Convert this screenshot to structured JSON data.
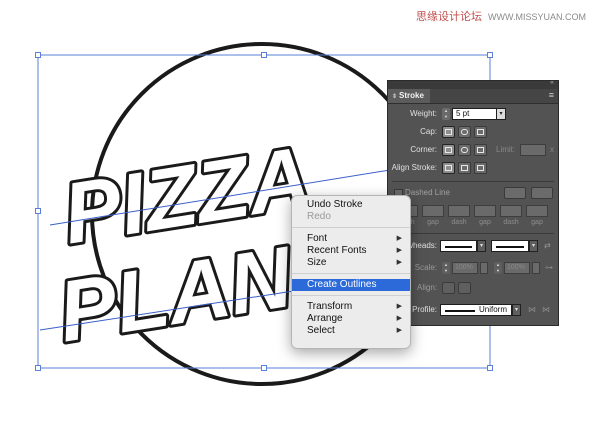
{
  "watermark": {
    "site_cn": "思缘设计论坛",
    "site_url": "WWW.MISSYUAN.COM"
  },
  "artwork": {
    "line1": "PIZZA",
    "line2": "PLANET"
  },
  "stroke_panel": {
    "title": "Stroke",
    "weight_label": "Weight:",
    "weight_value": "5 pt",
    "cap_label": "Cap:",
    "corner_label": "Corner:",
    "limit_label": "Limit:",
    "limit_x": "x",
    "align_label": "Align Stroke:",
    "dashed_line_label": "Dashed Line",
    "dash_labels": [
      "dash",
      "gap",
      "dash",
      "gap",
      "dash",
      "gap"
    ],
    "arrowheads_label": "Arrowheads:",
    "scale_label": "Scale:",
    "scale_start": "100%",
    "scale_end": "100%",
    "align_arrow_label": "Align:",
    "profile_label": "Profile:",
    "profile_value": "Uniform"
  },
  "context_menu": {
    "undo": "Undo Stroke",
    "redo": "Redo",
    "font": "Font",
    "recent_fonts": "Recent Fonts",
    "size": "Size",
    "create_outlines": "Create Outlines",
    "transform": "Transform",
    "arrange": "Arrange",
    "select": "Select"
  },
  "colors": {
    "selection": "#5a7fd6",
    "highlight": "#2c69d9",
    "panel_bg": "#535353"
  }
}
